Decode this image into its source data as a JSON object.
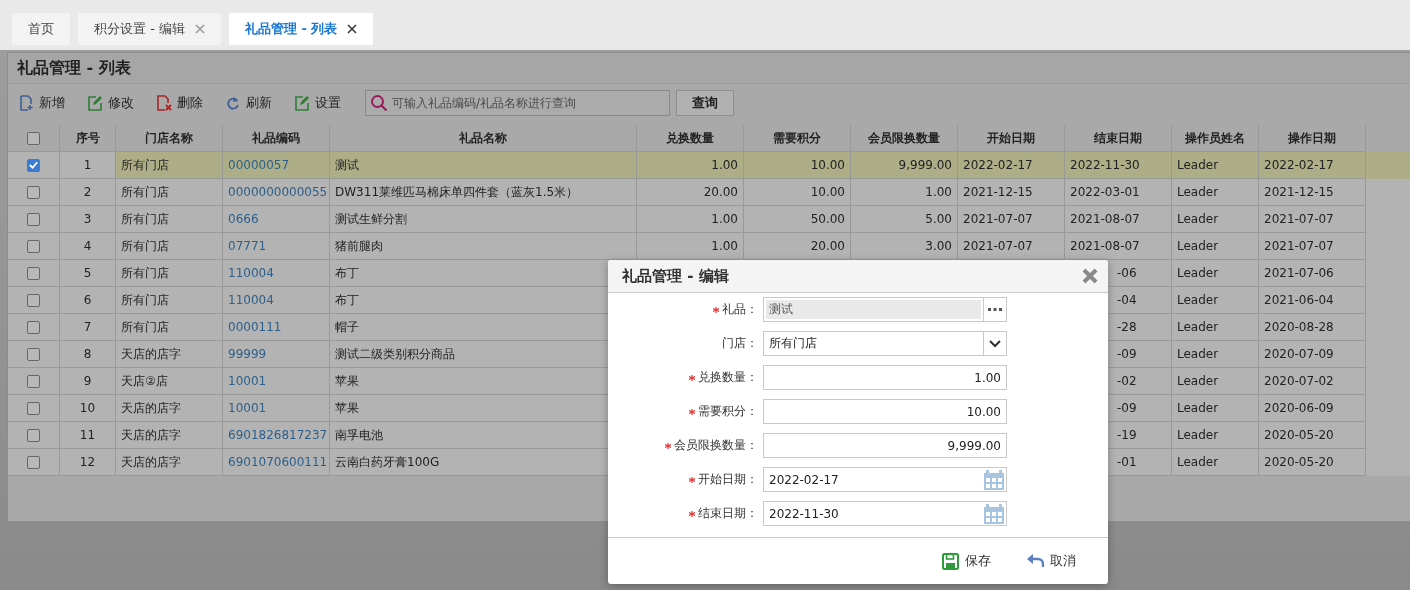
{
  "tabs": [
    {
      "label": "首页",
      "closable": false,
      "selected": false
    },
    {
      "label": "积分设置 - 编辑",
      "closable": true,
      "selected": false
    },
    {
      "label": "礼品管理 - 列表",
      "closable": true,
      "selected": true
    }
  ],
  "panel": {
    "title": "礼品管理 - 列表"
  },
  "toolbar": [
    {
      "kind": "add",
      "label": "新增"
    },
    {
      "kind": "edit",
      "label": "修改"
    },
    {
      "kind": "delete",
      "label": "删除"
    },
    {
      "kind": "refresh",
      "label": "刷新"
    },
    {
      "kind": "settings",
      "label": "设置"
    }
  ],
  "search": {
    "placeholder": "可输入礼品编码/礼品名称进行查询",
    "button": "查询"
  },
  "table": {
    "all_checked": false,
    "columns": [
      "序号",
      "门店名称",
      "礼品编码",
      "礼品名称",
      "兑换数量",
      "需要积分",
      "会员限换数量",
      "开始日期",
      "结束日期",
      "操作员姓名",
      "操作日期"
    ],
    "rows": [
      {
        "checked": true,
        "selected": true,
        "no": "1",
        "store": "所有门店",
        "code": "00000057",
        "name": "测试",
        "qty": "1.00",
        "points": "10.00",
        "limit": "9,999.00",
        "start": "2022-02-17",
        "end": "2022-11-30",
        "operator": "Leader",
        "op_date": "2022-02-17"
      },
      {
        "checked": false,
        "selected": false,
        "no": "2",
        "store": "所有门店",
        "code": "0000000000055",
        "name": "DW311莱维匹马棉床单四件套（蓝灰1.5米）",
        "qty": "20.00",
        "points": "10.00",
        "limit": "1.00",
        "start": "2021-12-15",
        "end": "2022-03-01",
        "operator": "Leader",
        "op_date": "2021-12-15"
      },
      {
        "checked": false,
        "selected": false,
        "no": "3",
        "store": "所有门店",
        "code": "0666",
        "name": "测试生鲜分割",
        "qty": "1.00",
        "points": "50.00",
        "limit": "5.00",
        "start": "2021-07-07",
        "end": "2021-08-07",
        "operator": "Leader",
        "op_date": "2021-07-07"
      },
      {
        "checked": false,
        "selected": false,
        "no": "4",
        "store": "所有门店",
        "code": "07771",
        "name": "猪前腿肉",
        "qty": "1.00",
        "points": "20.00",
        "limit": "3.00",
        "start": "2021-07-07",
        "end": "2021-08-07",
        "operator": "Leader",
        "op_date": "2021-07-07"
      },
      {
        "checked": false,
        "selected": false,
        "no": "5",
        "store": "所有门店",
        "code": "110004",
        "name": "布丁",
        "end": "-06",
        "operator": "Leader",
        "op_date": "2021-07-06"
      },
      {
        "checked": false,
        "selected": false,
        "no": "6",
        "store": "所有门店",
        "code": "110004",
        "name": "布丁",
        "end": "-04",
        "operator": "Leader",
        "op_date": "2021-06-04"
      },
      {
        "checked": false,
        "selected": false,
        "no": "7",
        "store": "所有门店",
        "code": "0000111",
        "name": "帽子",
        "end": "-28",
        "operator": "Leader",
        "op_date": "2020-08-28"
      },
      {
        "checked": false,
        "selected": false,
        "no": "8",
        "store": "天店的店字",
        "code": "99999",
        "name": "测试二级类别积分商品",
        "end": "-09",
        "operator": "Leader",
        "op_date": "2020-07-09"
      },
      {
        "checked": false,
        "selected": false,
        "no": "9",
        "store": "天店②店",
        "code": "10001",
        "name": "苹果",
        "end": "-02",
        "operator": "Leader",
        "op_date": "2020-07-02"
      },
      {
        "checked": false,
        "selected": false,
        "no": "10",
        "store": "天店的店字",
        "code": "10001",
        "name": "苹果",
        "end": "-09",
        "operator": "Leader",
        "op_date": "2020-06-09"
      },
      {
        "checked": false,
        "selected": false,
        "no": "11",
        "store": "天店的店字",
        "code": "6901826817237",
        "name": "南孚电池",
        "end": "-19",
        "operator": "Leader",
        "op_date": "2020-05-20"
      },
      {
        "checked": false,
        "selected": false,
        "no": "12",
        "store": "天店的店字",
        "code": "6901070600111",
        "name": "云南白药牙膏100G",
        "end": "-01",
        "operator": "Leader",
        "op_date": "2020-05-20"
      }
    ]
  },
  "dialog": {
    "title": "礼品管理 - 编辑",
    "fields": [
      {
        "kind": "lookup",
        "label": "礼品：",
        "required": true,
        "disabled": true,
        "value": "测试"
      },
      {
        "kind": "select",
        "label": "门店：",
        "required": false,
        "disabled": false,
        "value": "所有门店"
      },
      {
        "kind": "number",
        "label": "兑换数量：",
        "required": true,
        "disabled": false,
        "value": "1.00"
      },
      {
        "kind": "number",
        "label": "需要积分：",
        "required": true,
        "disabled": false,
        "value": "10.00"
      },
      {
        "kind": "number",
        "label": "会员限换数量：",
        "required": true,
        "disabled": false,
        "value": "9,999.00"
      },
      {
        "kind": "date",
        "label": "开始日期：",
        "required": true,
        "disabled": false,
        "value": "2022-02-17"
      },
      {
        "kind": "date",
        "label": "结束日期：",
        "required": true,
        "disabled": false,
        "value": "2022-11-30"
      }
    ],
    "buttons": [
      {
        "kind": "save",
        "label": "保存"
      },
      {
        "kind": "cancel",
        "label": "取消"
      }
    ]
  }
}
